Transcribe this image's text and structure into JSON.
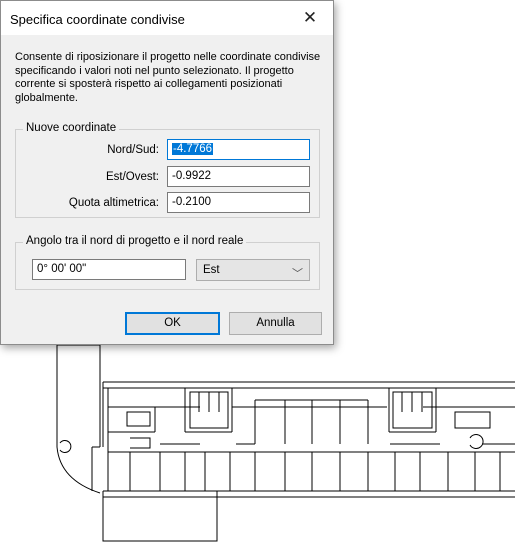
{
  "dialog": {
    "title": "Specifica coordinate condivise",
    "description": "Consente di riposizionare il progetto nelle coordinate condivise specificando i valori noti nel punto selezionato. Il progetto corrente si sposterà rispetto ai collegamenti posizionati globalmente.",
    "coords_group": {
      "legend": "Nuove coordinate",
      "north_label": "Nord/Sud:",
      "north_value": "-4.7766",
      "east_label": "Est/Ovest:",
      "east_value": "-0.9922",
      "elev_label": "Quota altimetrica:",
      "elev_value": "-0.2100"
    },
    "angle_group": {
      "legend": "Angolo tra il nord di progetto e il nord reale",
      "angle_value": "0° 00' 00\"",
      "direction_value": "Est"
    },
    "ok_label": "OK",
    "cancel_label": "Annulla"
  },
  "icons": {
    "close": "close-icon",
    "dropdown": "chevron-down-icon"
  },
  "colors": {
    "accent": "#0078d7",
    "dialog_bg": "#f0f0f0",
    "drawing_lines": "#000000"
  }
}
